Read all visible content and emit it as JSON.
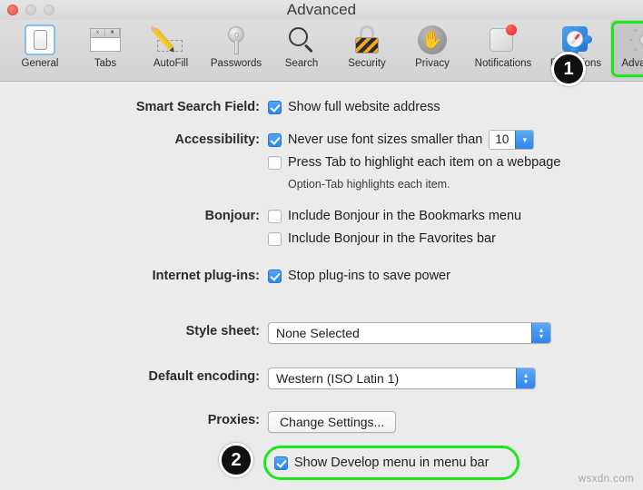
{
  "window": {
    "title": "Advanced",
    "traffic_lights": [
      "close",
      "minimize",
      "zoom"
    ]
  },
  "toolbar": {
    "tabs": [
      {
        "label": "General",
        "icon": "general-icon",
        "selected": false
      },
      {
        "label": "Tabs",
        "icon": "tabs-icon",
        "selected": false
      },
      {
        "label": "AutoFill",
        "icon": "autofill-pencil-icon",
        "selected": false
      },
      {
        "label": "Passwords",
        "icon": "key-icon",
        "selected": false
      },
      {
        "label": "Search",
        "icon": "search-icon",
        "selected": false
      },
      {
        "label": "Security",
        "icon": "lock-icon",
        "selected": false
      },
      {
        "label": "Privacy",
        "icon": "hand-icon",
        "selected": false
      },
      {
        "label": "Notifications",
        "icon": "notification-icon",
        "selected": false
      },
      {
        "label": "Extensions",
        "icon": "puzzle-icon",
        "selected": false
      },
      {
        "label": "Advanced",
        "icon": "gear-icon",
        "selected": true
      }
    ],
    "tabs_icon_cells": [
      "x",
      "■"
    ]
  },
  "annotations": {
    "badge_1": "1",
    "badge_2": "2",
    "highlight_color": "#18e81c"
  },
  "form": {
    "smart_search": {
      "label": "Smart Search Field:",
      "checkbox_label": "Show full website address",
      "checked": true
    },
    "accessibility": {
      "label": "Accessibility:",
      "font_size_label": "Never use font sizes smaller than",
      "font_size_checked": true,
      "font_size_value": "10",
      "tab_highlight_label": "Press Tab to highlight each item on a webpage",
      "tab_highlight_checked": false,
      "hint": "Option-Tab highlights each item."
    },
    "bonjour": {
      "label": "Bonjour:",
      "bookmarks_label": "Include Bonjour in the Bookmarks menu",
      "bookmarks_checked": false,
      "favorites_label": "Include Bonjour in the Favorites bar",
      "favorites_checked": false
    },
    "plugins": {
      "label": "Internet plug-ins:",
      "checkbox_label": "Stop plug-ins to save power",
      "checked": true
    },
    "style_sheet": {
      "label": "Style sheet:",
      "value": "None Selected"
    },
    "default_encoding": {
      "label": "Default encoding:",
      "value": "Western (ISO Latin 1)"
    },
    "proxies": {
      "label": "Proxies:",
      "button_label": "Change Settings..."
    },
    "develop": {
      "checkbox_label": "Show Develop menu in menu bar",
      "checked": true
    }
  },
  "watermark": "wsxdn.com"
}
